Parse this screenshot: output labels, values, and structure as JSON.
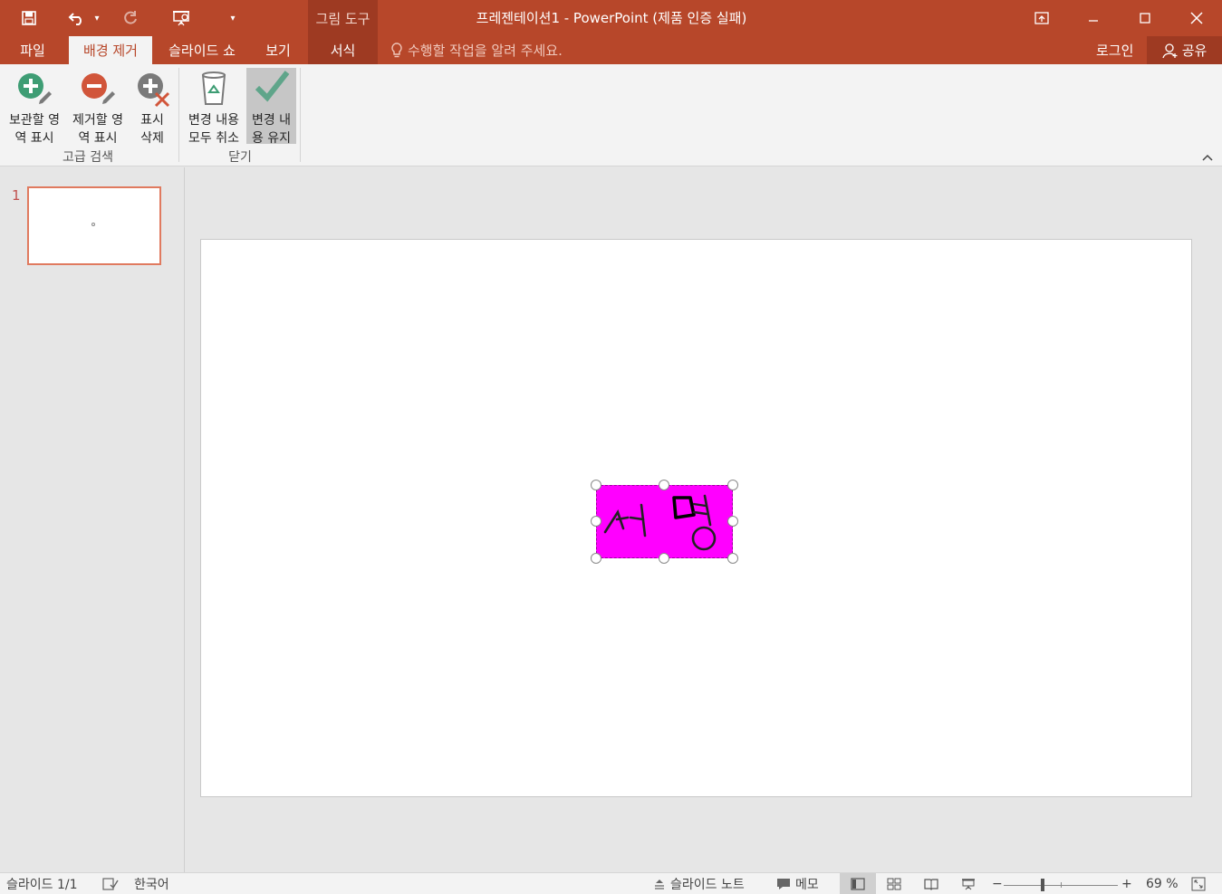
{
  "title_bar": {
    "window_title": "프레젠테이션1 - PowerPoint (제품 인증 실패)",
    "context_header": "그림 도구",
    "qat": {
      "save_icon": "save-icon",
      "undo_icon": "undo-icon",
      "redo_icon": "redo-icon",
      "presentation_icon": "start-slideshow-icon",
      "customize_icon": "customize-qat-icon"
    },
    "window_buttons": [
      "ribbon-display-options",
      "minimize",
      "maximize",
      "close"
    ]
  },
  "tabs": [
    {
      "id": "file",
      "label": "파일"
    },
    {
      "id": "remove-background",
      "label": "배경 제거",
      "active": true
    },
    {
      "id": "slideshow",
      "label": "슬라이드 쇼"
    },
    {
      "id": "view",
      "label": "보기"
    },
    {
      "id": "format",
      "label": "서식",
      "context": true
    }
  ],
  "tell_me": "수행할 작업을 알려 주세요.",
  "signin": "로그인",
  "share": "공유",
  "ribbon": {
    "groups": [
      {
        "label": "고급 검색",
        "buttons": [
          {
            "label": "보관할 영\n역 표시",
            "icon": "mark-areas-to-keep-icon"
          },
          {
            "label": "제거할 영\n역 표시",
            "icon": "mark-areas-to-remove-icon"
          },
          {
            "label": "표시\n삭제",
            "icon": "delete-mark-icon"
          }
        ]
      },
      {
        "label": "닫기",
        "buttons": [
          {
            "label": "변경 내용\n모두 취소",
            "icon": "discard-all-changes-icon"
          },
          {
            "label": "변경 내\n용 유지",
            "icon": "keep-changes-icon",
            "pressed": true
          }
        ]
      }
    ]
  },
  "thumbnails": [
    {
      "number": "1"
    }
  ],
  "picture": {
    "fill_color": "#ff00ff",
    "handwriting": "서명"
  },
  "status_bar": {
    "slide_info": "슬라이드 1/1",
    "language": "한국어",
    "notes": "슬라이드 노트",
    "comments": "메모",
    "zoom_minus": "−",
    "zoom_plus": "+",
    "zoom": "69 %"
  },
  "colors": {
    "accent": "#b7472a",
    "accent_dark": "#9e3a22",
    "thumb_border": "#e07a5f"
  }
}
